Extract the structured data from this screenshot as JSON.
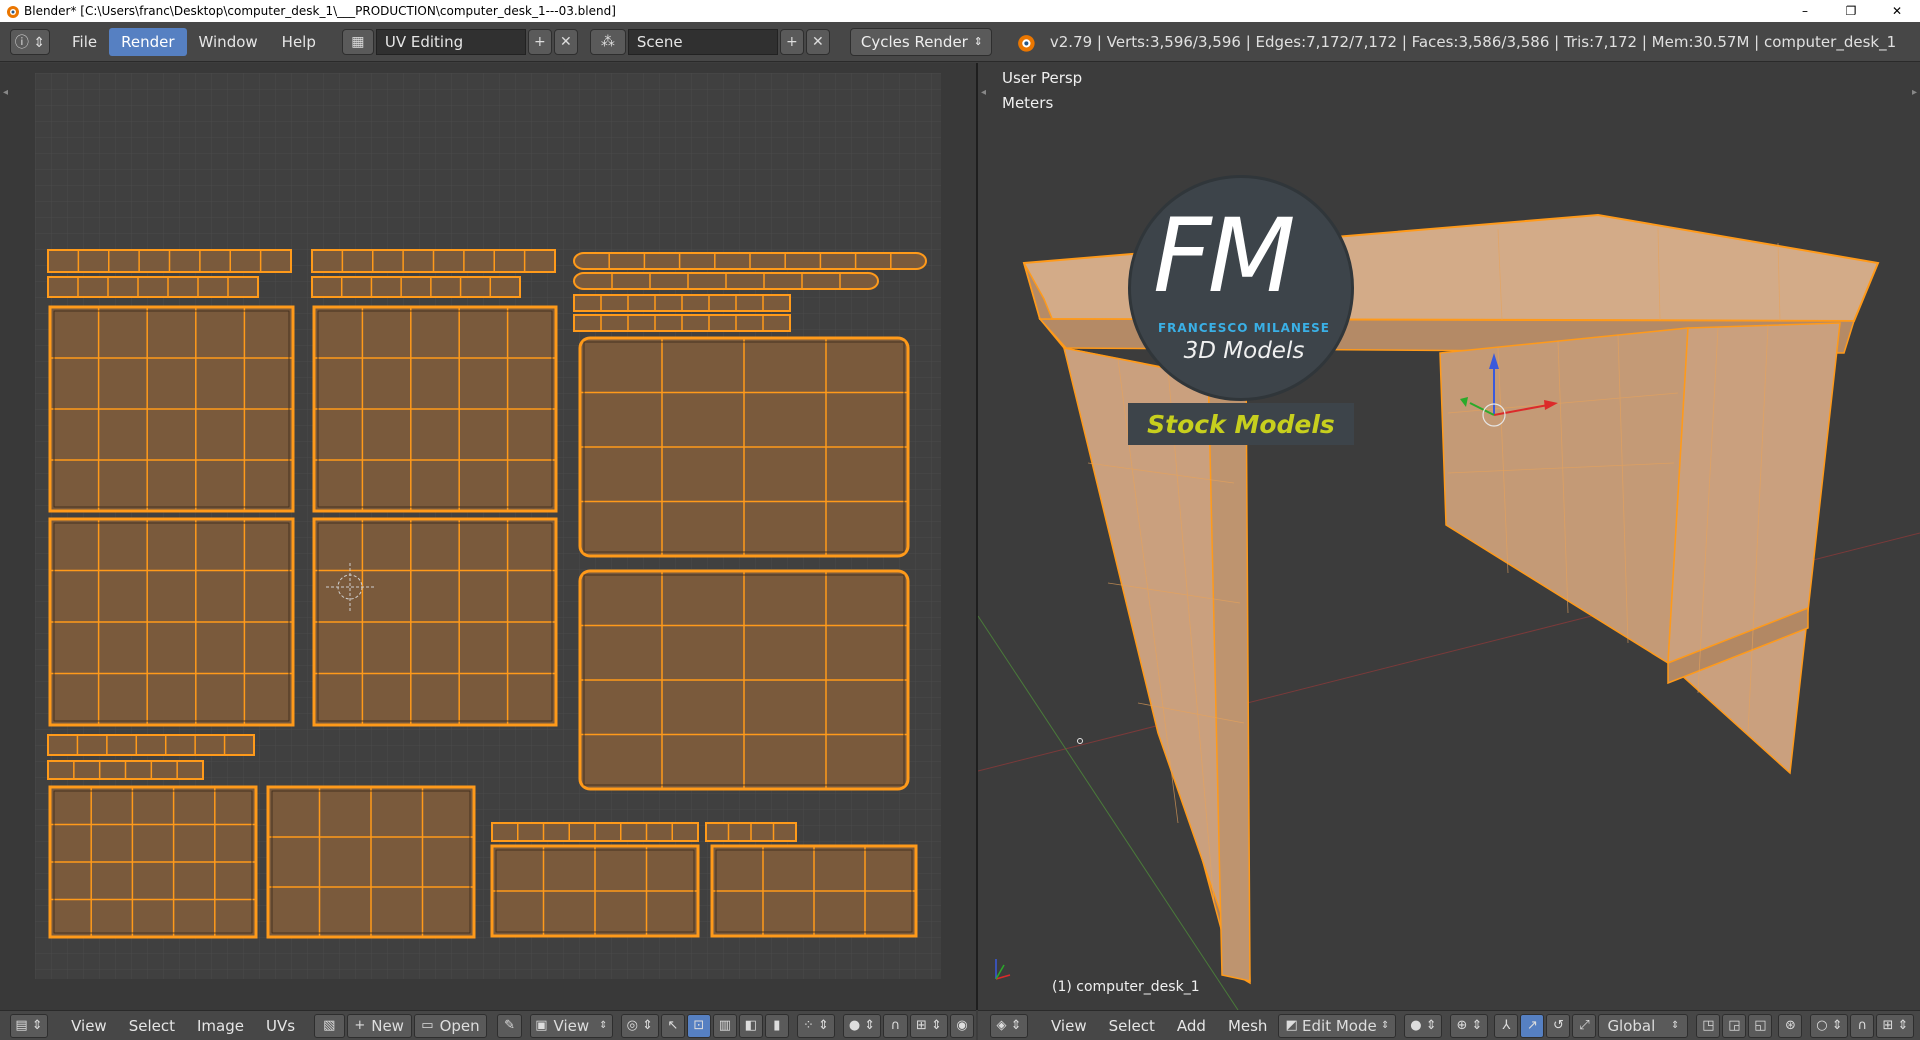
{
  "window": {
    "title": "Blender* [C:\\Users\\franc\\Desktop\\computer_desk_1\\___PRODUCTION\\computer_desk_1---03.blend]",
    "minimize": "–",
    "restore": "❐",
    "close": "✕"
  },
  "infobar": {
    "menus": [
      "File",
      "Render",
      "Window",
      "Help"
    ],
    "active_menu": "Render",
    "layout_name": "UV Editing",
    "scene_name": "Scene",
    "render_engine": "Cycles Render",
    "stats": "v2.79 | Verts:3,596/3,596 | Edges:7,172/7,172 | Faces:3,586/3,586 | Tris:7,172 | Mem:30.57M | computer_desk_1"
  },
  "uv_editor": {
    "footer_menus": [
      "View",
      "Select",
      "Image",
      "UVs"
    ],
    "new_label": "New",
    "open_label": "Open",
    "view_label": "View"
  },
  "viewport": {
    "view_name": "User Persp",
    "units": "Meters",
    "object_label": "(1) computer_desk_1",
    "footer_menus": [
      "View",
      "Select",
      "Add",
      "Mesh"
    ],
    "mode": "Edit Mode",
    "orientation": "Global"
  },
  "watermark": {
    "initials": "FM",
    "name": "FRANCESCO MILANESE",
    "tagline": "3D Models",
    "banner": "Stock Models"
  },
  "colors": {
    "accent": "#5680c2",
    "uv_fill": "#7a5a3c",
    "uv_edge": "#ff9a1a",
    "desk_fill": "#c9a07c"
  }
}
